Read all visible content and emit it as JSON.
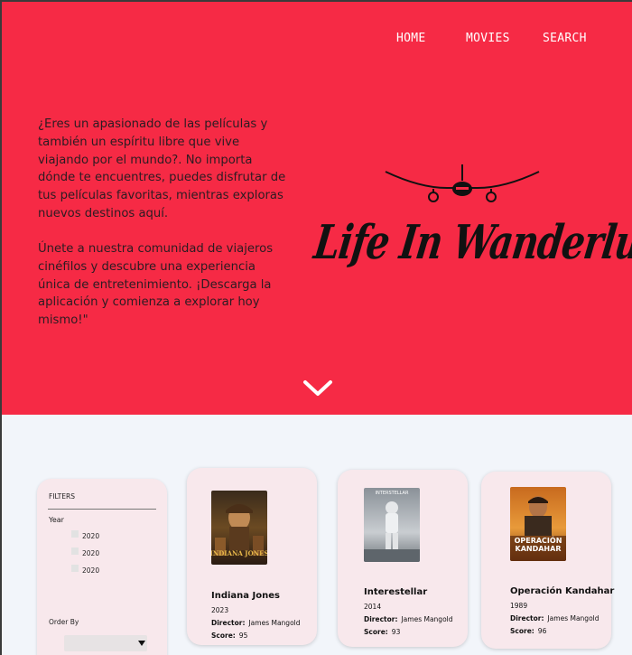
{
  "nav": {
    "home": "HOME",
    "movies": "MOVIES",
    "search": "SEARCH"
  },
  "hero": {
    "paragraph_1": "¿Eres un apasionado de las películas y también un espíritu libre que vive viajando por el mundo?. No importa dónde te encuentres, puedes disfrutar de tus películas favoritas, mientras exploras nuevos destinos aquí.",
    "paragraph_2": "Únete a nuestra comunidad de viajeros cinéfilos y descubre una experiencia única de entretenimiento. ¡Descarga la aplicación y comienza a explorar hoy mismo!\"",
    "brand": "Life In Wanderlust",
    "logo_icon": "airplane-icon",
    "scroll_icon": "chevron-down-icon"
  },
  "filters": {
    "title": "FILTERS",
    "year_label": "Year",
    "years": [
      "2020",
      "2020",
      "2020"
    ],
    "order_by_label": "Order By",
    "order_by_value": ""
  },
  "movies": [
    {
      "title": "Indiana Jones",
      "year": "2023",
      "director_label": "Director:",
      "director": "James Mangold",
      "score_label": "Score:",
      "score": "95"
    },
    {
      "title": "Interestellar",
      "year": "2014",
      "director_label": "Director:",
      "director": "James Mangold",
      "score_label": "Score:",
      "score": "93"
    },
    {
      "title": "Operación Kandahar",
      "year": "1989",
      "director_label": "Director:",
      "director": "James Mangold",
      "score_label": "Score:",
      "score": "96"
    }
  ],
  "posters": {
    "indiana_jones_text": "INDIANA JONES",
    "interstellar_text": "INTERSTELLAR",
    "kandahar_text_1": "OPERACIÓN",
    "kandahar_text_2": "KANDAHAR"
  },
  "colors": {
    "hero_bg": "#f62a45",
    "page_bg": "#f2f5fa",
    "card_bg": "#f8e8ec"
  }
}
